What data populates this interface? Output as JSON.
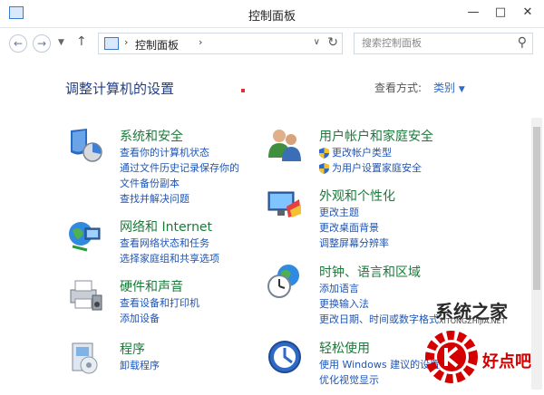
{
  "window": {
    "title": "控制面板"
  },
  "nav": {
    "breadcrumb": "控制面板",
    "search_placeholder": "搜索控制面板"
  },
  "page": {
    "heading": "调整计算机的设置",
    "view_by_label": "查看方式:",
    "view_by_value": "类别"
  },
  "categories": [
    {
      "title": "系统和安全",
      "icon": "security-shield-icon",
      "links": [
        "查看你的计算机状态",
        "通过文件历史记录保存你的",
        "文件备份副本",
        "查找并解决问题"
      ]
    },
    {
      "title": "网络和 Internet",
      "icon": "network-globe-icon",
      "links": [
        "查看网络状态和任务",
        "选择家庭组和共享选项"
      ]
    },
    {
      "title": "硬件和声音",
      "icon": "printer-icon",
      "links": [
        "查看设备和打印机",
        "添加设备"
      ]
    },
    {
      "title": "程序",
      "icon": "programs-icon",
      "links": [
        "卸载程序"
      ]
    },
    {
      "title": "用户帐户和家庭安全",
      "icon": "users-icon",
      "links": [
        "更改帐户类型",
        "为用户设置家庭安全"
      ]
    },
    {
      "title": "外观和个性化",
      "icon": "monitor-palette-icon",
      "links": [
        "更改主题",
        "更改桌面背景",
        "调整屏幕分辨率"
      ]
    },
    {
      "title": "时钟、语言和区域",
      "icon": "clock-globe-icon",
      "links": [
        "添加语言",
        "更换输入法",
        "更改日期、时间或数字格式"
      ]
    },
    {
      "title": "轻松使用",
      "icon": "ease-of-access-icon",
      "links": [
        "使用 Windows 建议的设置",
        "优化视觉显示"
      ]
    }
  ],
  "watermark": {
    "site_name": "系统之家",
    "site_url": "XITONGZHIJIA.NET",
    "brand": "好点吧"
  },
  "colors": {
    "heading": "#1e3f8c",
    "category_title": "#1b7a3a",
    "link": "#1e55b6",
    "view_by_value": "#2f6ac7",
    "watermark_red": "#d40000"
  }
}
